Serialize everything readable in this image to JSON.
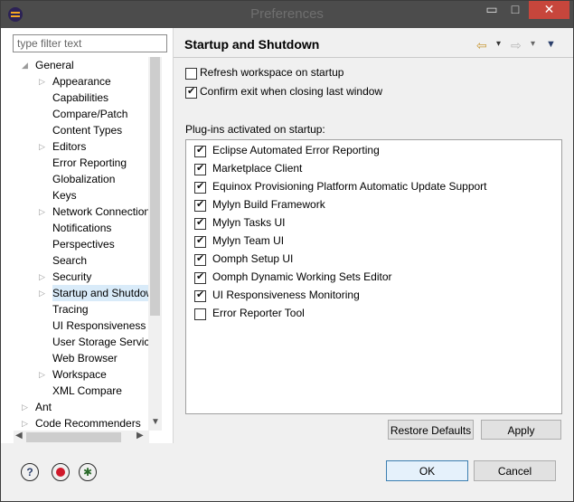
{
  "window": {
    "title": "Preferences",
    "minimize": "▭",
    "maximize": "□",
    "close": "✕"
  },
  "filter": {
    "placeholder": "type filter text"
  },
  "tree": {
    "items": [
      {
        "label": "General",
        "arrow": "◢"
      },
      {
        "label": "Appearance",
        "arrow": "▷"
      },
      {
        "label": "Capabilities",
        "arrow": ""
      },
      {
        "label": "Compare/Patch",
        "arrow": ""
      },
      {
        "label": "Content Types",
        "arrow": ""
      },
      {
        "label": "Editors",
        "arrow": "▷"
      },
      {
        "label": "Error Reporting",
        "arrow": ""
      },
      {
        "label": "Globalization",
        "arrow": ""
      },
      {
        "label": "Keys",
        "arrow": ""
      },
      {
        "label": "Network Connection",
        "arrow": "▷"
      },
      {
        "label": "Notifications",
        "arrow": ""
      },
      {
        "label": "Perspectives",
        "arrow": ""
      },
      {
        "label": "Search",
        "arrow": ""
      },
      {
        "label": "Security",
        "arrow": "▷"
      },
      {
        "label": "Startup and Shutdown",
        "arrow": "▷",
        "selected": true
      },
      {
        "label": "Tracing",
        "arrow": ""
      },
      {
        "label": "UI Responsiveness Monitoring",
        "arrow": ""
      },
      {
        "label": "User Storage Service",
        "arrow": ""
      },
      {
        "label": "Web Browser",
        "arrow": ""
      },
      {
        "label": "Workspace",
        "arrow": "▷"
      },
      {
        "label": "XML Compare",
        "arrow": ""
      },
      {
        "label": "Ant",
        "arrow": "▷"
      },
      {
        "label": "Code Recommenders",
        "arrow": "▷"
      }
    ]
  },
  "page": {
    "title": "Startup and Shutdown",
    "nav_back": "⇦",
    "nav_fwd": "⇨",
    "drop": "▾",
    "options": [
      {
        "label": "Refresh workspace on startup",
        "checked": false
      },
      {
        "label": "Confirm exit when closing last window",
        "checked": true
      }
    ],
    "plugins_label": "Plug-ins activated on startup:",
    "plugins": [
      {
        "label": "Eclipse Automated Error Reporting",
        "checked": true
      },
      {
        "label": "Marketplace Client",
        "checked": true
      },
      {
        "label": "Equinox Provisioning Platform Automatic Update Support",
        "checked": true
      },
      {
        "label": "Mylyn Build Framework",
        "checked": true
      },
      {
        "label": "Mylyn Tasks UI",
        "checked": true
      },
      {
        "label": "Mylyn Team UI",
        "checked": true
      },
      {
        "label": "Oomph Setup UI",
        "checked": true
      },
      {
        "label": "Oomph Dynamic Working Sets Editor",
        "checked": true
      },
      {
        "label": "UI Responsiveness Monitoring",
        "checked": true
      },
      {
        "label": "Error Reporter Tool",
        "checked": false
      }
    ],
    "restore_label": "Restore Defaults",
    "apply_label": "Apply"
  },
  "footer": {
    "help_glyph": "?",
    "tip_glyph": "💡",
    "ok_label": "OK",
    "cancel_label": "Cancel"
  }
}
